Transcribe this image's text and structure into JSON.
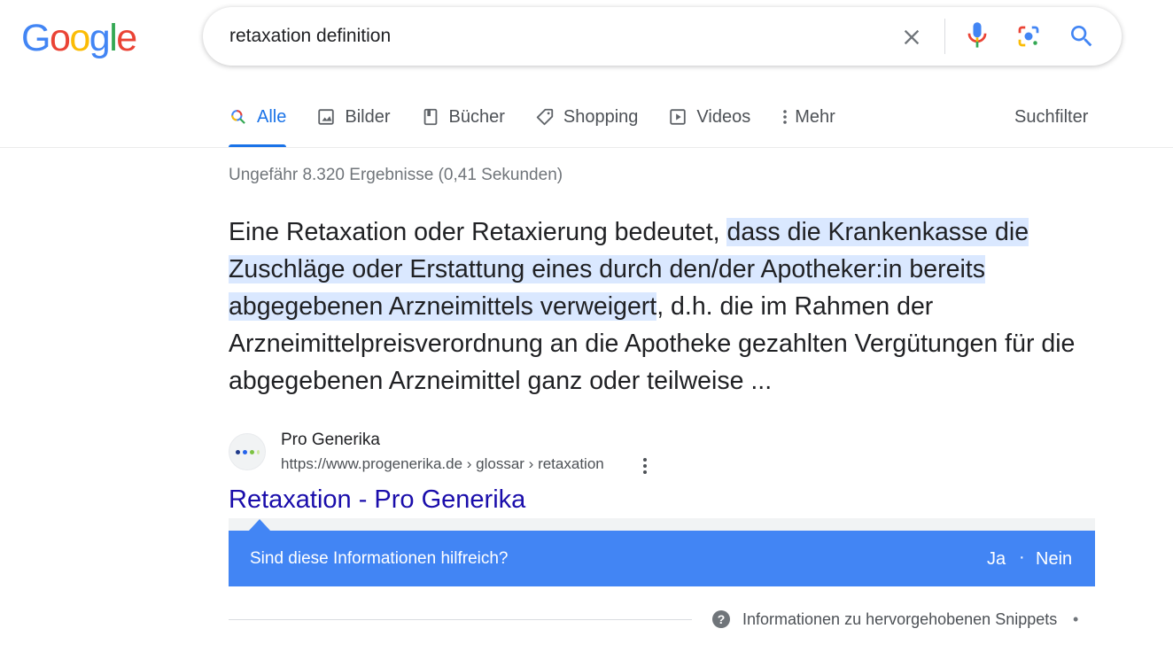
{
  "header": {
    "logo_letters": [
      {
        "ch": "G",
        "color": "#4285f4"
      },
      {
        "ch": "o",
        "color": "#ea4335"
      },
      {
        "ch": "o",
        "color": "#fbbc05"
      },
      {
        "ch": "g",
        "color": "#4285f4"
      },
      {
        "ch": "l",
        "color": "#34a853"
      },
      {
        "ch": "e",
        "color": "#ea4335"
      }
    ],
    "search_query": "retaxation definition"
  },
  "tabs": [
    {
      "label": "Alle",
      "icon": "search-icon",
      "active": true
    },
    {
      "label": "Bilder",
      "icon": "image-icon"
    },
    {
      "label": "Bücher",
      "icon": "book-icon"
    },
    {
      "label": "Shopping",
      "icon": "tag-icon"
    },
    {
      "label": "Videos",
      "icon": "play-icon"
    },
    {
      "label": "Mehr",
      "icon": "more-vert-icon"
    }
  ],
  "suchfilter_label": "Suchfilter",
  "stats": "Ungefähr 8.320 Ergebnisse (0,41 Sekunden)",
  "snippet": {
    "before": "Eine Retaxation oder Retaxierung bedeutet, ",
    "highlight": "dass die Krankenkasse die Zuschläge oder Erstattung eines durch den/der Apotheker:in bereits abgegebenen Arzneimittels verweigert",
    "after": ", d.h. die im Rahmen der Arzneimittelpreisverordnung an die Apotheke gezahlten Vergütungen für die abgegebenen Arzneimittel ganz oder teilweise ..."
  },
  "source": {
    "site_name": "Pro Generika",
    "url": "https://www.progenerika.de › glossar › retaxation",
    "title": "Retaxation - Pro Generika"
  },
  "feedback": {
    "question": "Sind diese Informationen hilfreich?",
    "yes": "Ja",
    "separator": "·",
    "no": "Nein"
  },
  "footer": {
    "info_icon_label": "?",
    "info_text": "Informationen zu hervorgehobenen Snippets",
    "dot": "•"
  },
  "colors": {
    "accent": "#1a73e8",
    "link": "#1a0dab",
    "feedback_bg": "#4285f4",
    "highlight": "#d3e3fd"
  }
}
